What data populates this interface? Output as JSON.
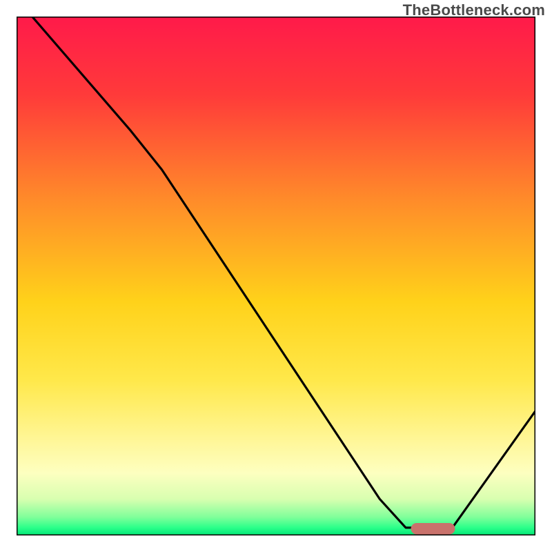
{
  "attribution": "TheBottleneck.com",
  "chart_data": {
    "type": "line",
    "title": "",
    "xlabel": "",
    "ylabel": "",
    "xlim": [
      0,
      100
    ],
    "ylim": [
      0,
      100
    ],
    "grid": false,
    "legend": false,
    "gradient_stops": [
      {
        "offset": 0.0,
        "color": "#ff1a4a"
      },
      {
        "offset": 0.15,
        "color": "#ff3a3a"
      },
      {
        "offset": 0.35,
        "color": "#ff8a2a"
      },
      {
        "offset": 0.55,
        "color": "#ffd21a"
      },
      {
        "offset": 0.7,
        "color": "#ffe84a"
      },
      {
        "offset": 0.82,
        "color": "#fff79a"
      },
      {
        "offset": 0.88,
        "color": "#fdffc0"
      },
      {
        "offset": 0.93,
        "color": "#d8ffb0"
      },
      {
        "offset": 0.965,
        "color": "#7fff9a"
      },
      {
        "offset": 0.985,
        "color": "#2bff8a"
      },
      {
        "offset": 1.0,
        "color": "#00e676"
      }
    ],
    "black_curve": {
      "description": "bottleneck curve, lower = better, minimum around x≈78-84",
      "points": [
        {
          "x": 3.0,
          "y": 100.0
        },
        {
          "x": 22.0,
          "y": 78.0
        },
        {
          "x": 28.0,
          "y": 70.5
        },
        {
          "x": 70.0,
          "y": 7.0
        },
        {
          "x": 75.0,
          "y": 1.5
        },
        {
          "x": 84.0,
          "y": 1.5
        },
        {
          "x": 100.0,
          "y": 24.0
        }
      ]
    },
    "highlight_bar": {
      "description": "red rounded bar marking the optimal range at the bottom of the curve",
      "x_start": 76.0,
      "x_end": 84.5,
      "y": 1.3,
      "thickness_pct": 2.2,
      "color": "#c9726c"
    }
  }
}
